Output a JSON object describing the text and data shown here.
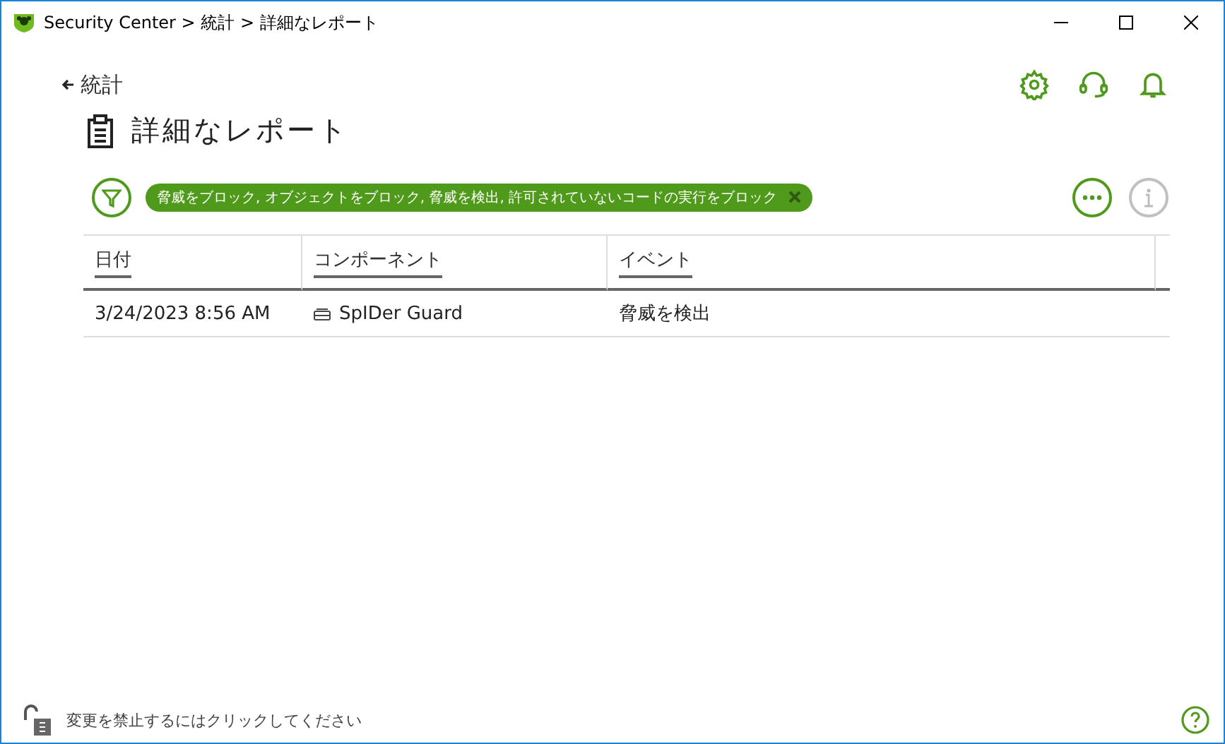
{
  "window": {
    "title": "Security Center > 統計 > 詳細なレポート"
  },
  "back": {
    "label": "統計"
  },
  "heading": "詳細なレポート",
  "filter": {
    "chip": "脅威をブロック, オブジェクトをブロック, 脅威を検出, 許可されていないコードの実行をブロック"
  },
  "table": {
    "columns": [
      "日付",
      "コンポーネント",
      "イベント"
    ],
    "rows": [
      {
        "date": "3/24/2023 8:56 AM",
        "component": "SpIDer Guard",
        "event": "脅威を検出"
      }
    ]
  },
  "status_bar": {
    "lock_text": "変更を禁止するにはクリックしてください"
  }
}
